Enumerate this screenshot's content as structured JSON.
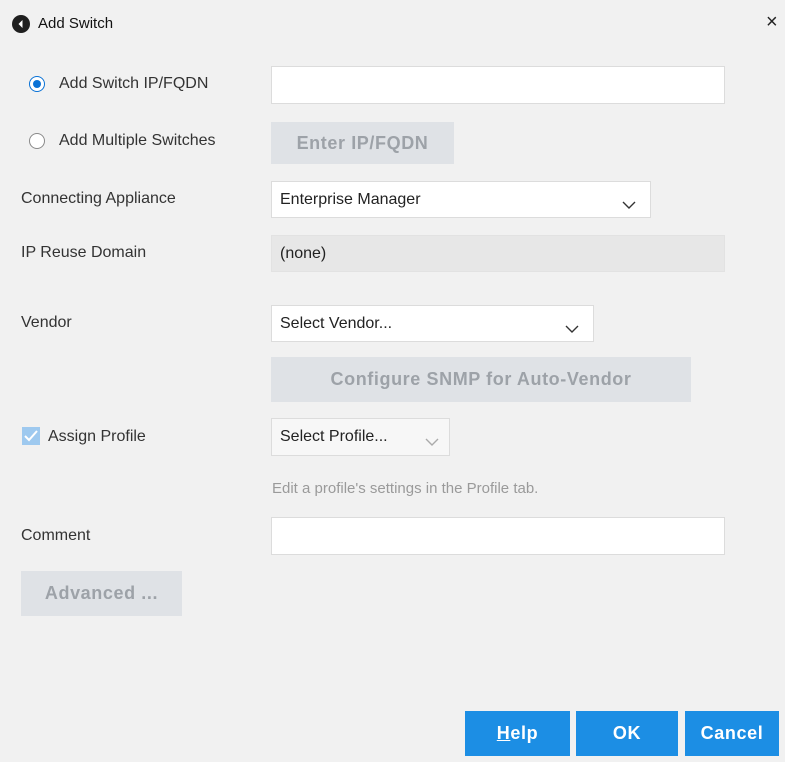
{
  "window": {
    "title": "Add Switch",
    "close_glyph": "×"
  },
  "form": {
    "add_switch_radio_label": "Add Switch IP/FQDN",
    "add_switch_value": "",
    "add_multiple_radio_label": "Add Multiple Switches",
    "enter_ip_button": "Enter IP/FQDN",
    "connecting_appliance_label": "Connecting Appliance",
    "connecting_appliance_value": "Enterprise Manager",
    "ip_reuse_label": "IP Reuse Domain",
    "ip_reuse_value": "(none)",
    "vendor_label": "Vendor",
    "vendor_value": "Select Vendor...",
    "configure_snmp_button": "Configure SNMP for Auto-Vendor",
    "assign_profile_label": "Assign Profile",
    "assign_profile_checked": true,
    "profile_value": "Select Profile...",
    "profile_hint": "Edit a profile's settings in the Profile tab.",
    "comment_label": "Comment",
    "comment_value": "",
    "advanced_button": "Advanced ..."
  },
  "footer": {
    "help_label_mnemonic": "H",
    "help_label_rest": "elp",
    "ok_label": "OK",
    "cancel_label": "Cancel"
  },
  "colors": {
    "accent": "#1c8ee4",
    "radio_selected": "#0a72d6",
    "disabled_button_bg": "#dfe2e6",
    "disabled_button_text": "#9da2a8",
    "background": "#f1f1f1"
  },
  "icons": {
    "app": "back-arrow-circle-icon",
    "close": "close-icon",
    "dropdown": "chevron-down-icon",
    "check": "checkmark-icon"
  }
}
